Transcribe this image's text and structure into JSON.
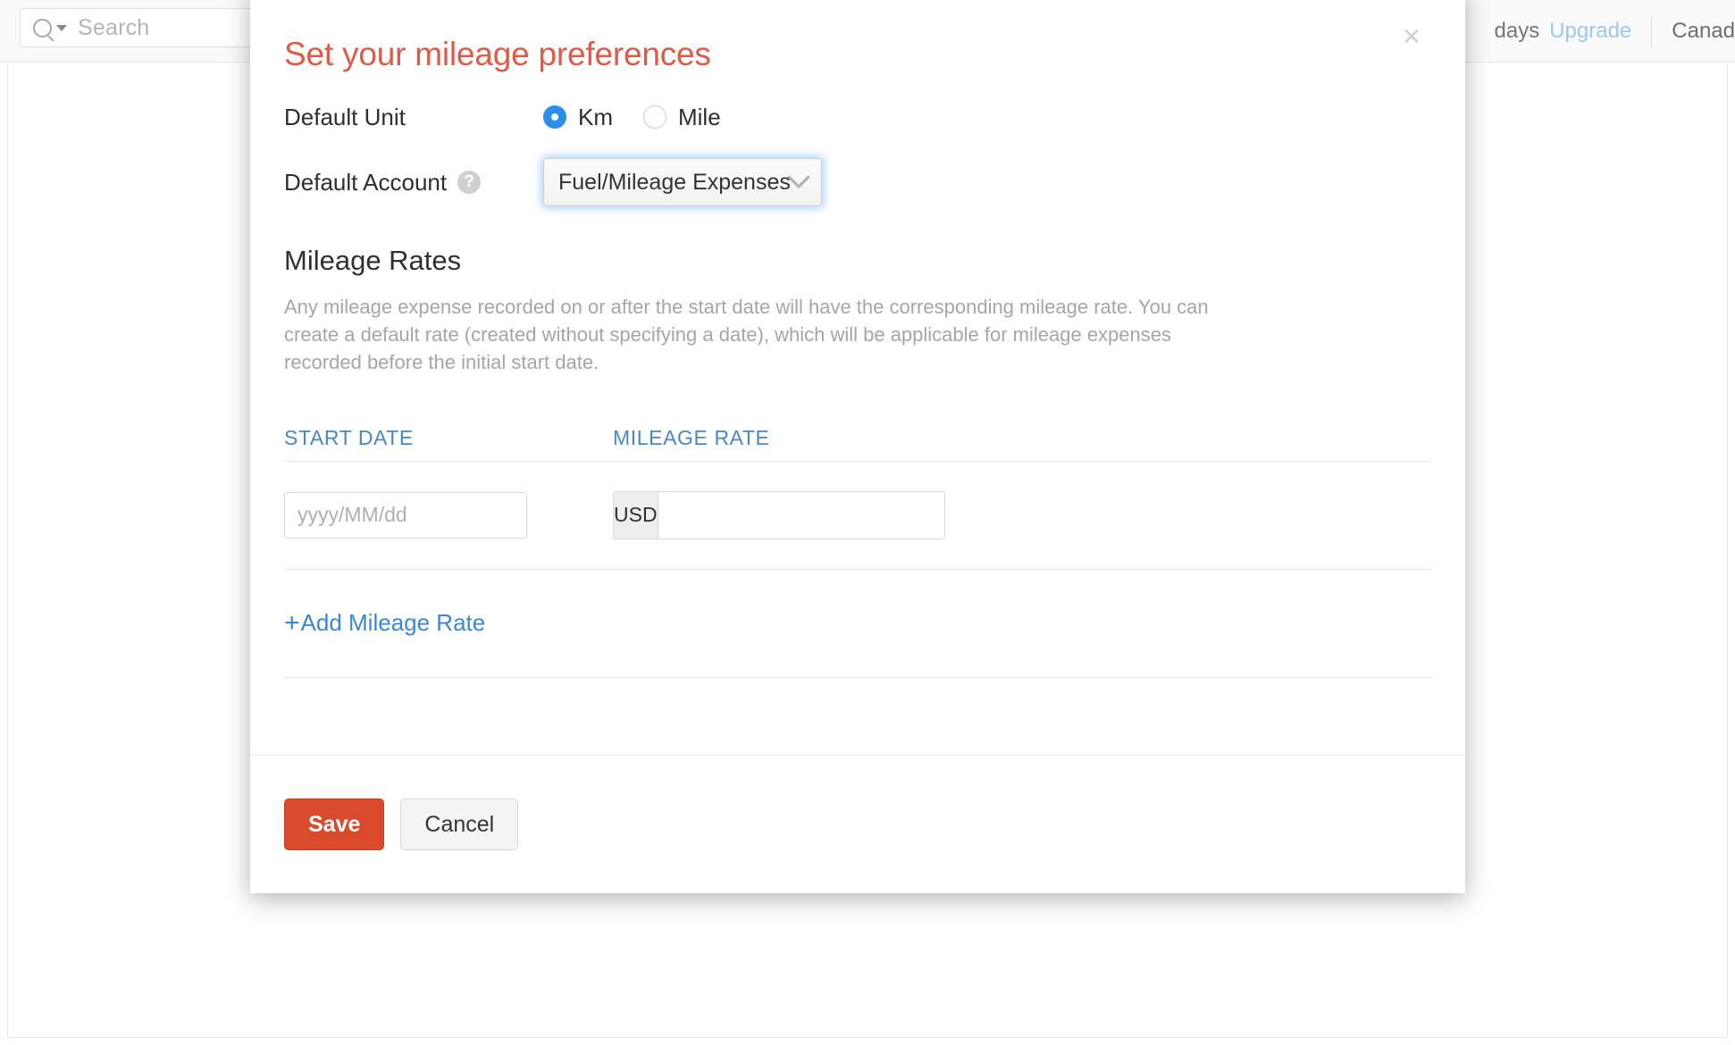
{
  "app": {
    "search": {
      "placeholder": "Search",
      "icon": "search-icon",
      "caret": "chevron-down-icon"
    },
    "topbar_right": {
      "trial_text": "days",
      "upgrade_label": "Upgrade",
      "region_label": "Canad"
    }
  },
  "modal": {
    "title": "Set your mileage preferences",
    "close_label": "×",
    "default_unit": {
      "label": "Default Unit",
      "options": [
        {
          "label": "Km",
          "selected": true
        },
        {
          "label": "Mile",
          "selected": false
        }
      ]
    },
    "default_account": {
      "label": "Default Account",
      "help_icon": "?",
      "selected_value": "Fuel/Mileage Expenses",
      "chevron": "chevron-down-icon"
    },
    "mileage_rates": {
      "section_title": "Mileage Rates",
      "description": "Any mileage expense recorded on or after the start date will have the corresponding mileage rate. You can create a default rate (created without specifying a date), which will be applicable for mileage expenses recorded before the initial start date.",
      "columns": [
        "START DATE",
        "MILEAGE RATE"
      ],
      "rows": [
        {
          "start_date_value": "",
          "start_date_placeholder": "yyyy/MM/dd",
          "currency": "USD",
          "rate_value": "",
          "rate_placeholder": ""
        }
      ],
      "add_link": {
        "plus": "+",
        "label": "Add Mileage Rate"
      }
    },
    "footer": {
      "save_label": "Save",
      "cancel_label": "Cancel"
    }
  },
  "colors": {
    "title_red": "#e05a47",
    "save_red": "#da4b2d",
    "link_blue": "#3b87d0",
    "header_blue": "#4a87c4",
    "radio_blue": "#2d8eea",
    "muted_gray": "#a6a6a6"
  }
}
